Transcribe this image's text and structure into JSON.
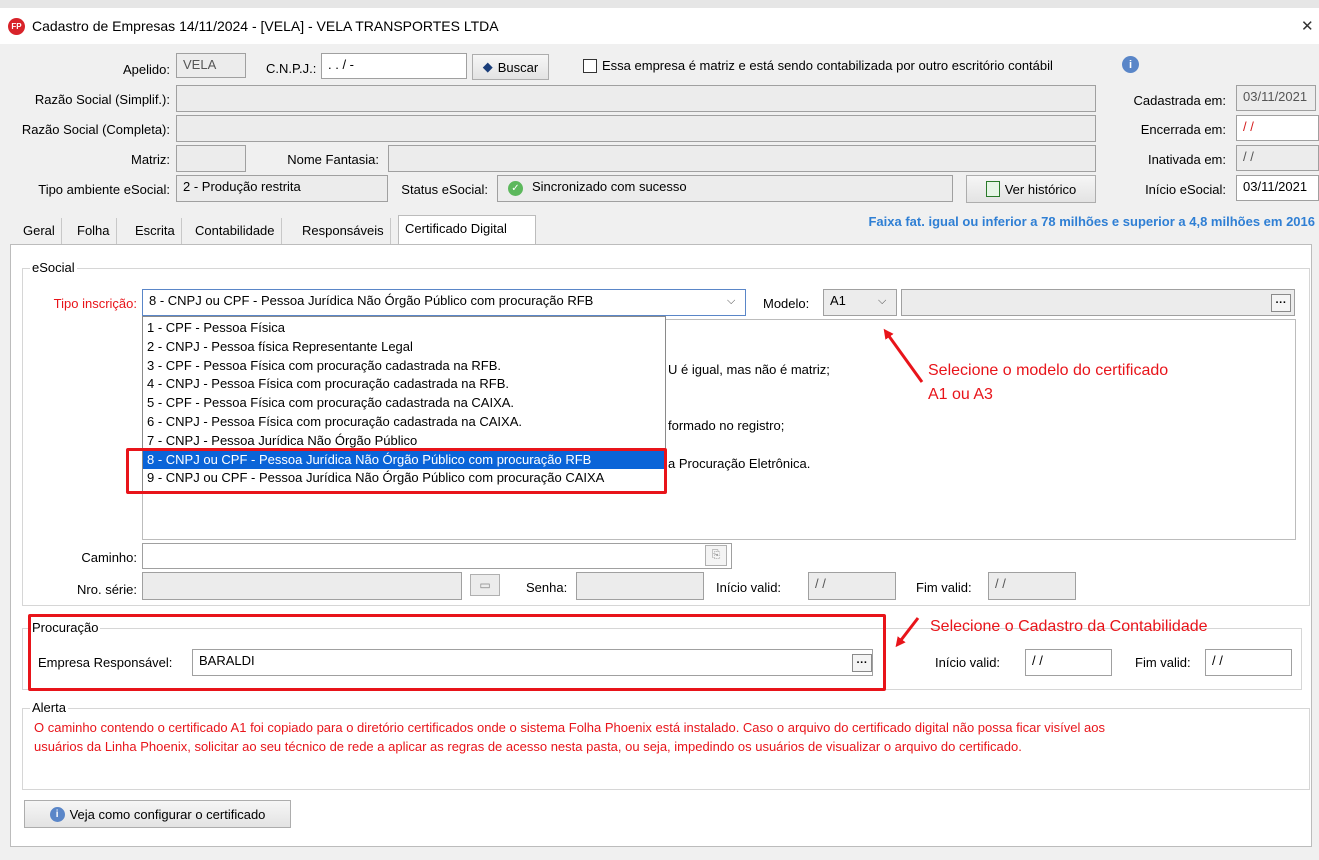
{
  "window": {
    "logo": "FP",
    "title": "Cadastro de Empresas  14/11/2024 - [VELA] - VELA TRANSPORTES LTDA",
    "close_glyph": "✕"
  },
  "header": {
    "apelido_label": "Apelido:",
    "apelido_value": "VELA",
    "cnpj_label": "C.N.P.J.:",
    "cnpj_value": " . . /  -",
    "buscar_label": "Buscar",
    "matriz_checkbox_label": "Essa empresa é matriz e está sendo contabilizada por outro escritório contábil",
    "razao_simpl_label": "Razão Social (Simplif.):",
    "razao_simpl_value": "",
    "razao_compl_label": "Razão Social (Completa):",
    "razao_compl_value": "",
    "matriz_label": "Matriz:",
    "matriz_value": "",
    "nome_fantasia_label": "Nome Fantasia:",
    "nome_fantasia_value": "",
    "tipo_ambiente_label": "Tipo ambiente eSocial:",
    "tipo_ambiente_value": "2 - Produção restrita",
    "status_label": "Status eSocial:",
    "status_value": "Sincronizado com sucesso",
    "ver_historico_label": "Ver histórico",
    "cadastrada_label": "Cadastrada em:",
    "cadastrada_value": "03/11/2021",
    "encerrada_label": "Encerrada em:",
    "encerrada_value": "/ /",
    "inativada_label": "Inativada em:",
    "inativada_value": "/ /",
    "inicio_esocial_label": "Início eSocial:",
    "inicio_esocial_value": "03/11/2021"
  },
  "tabs": [
    {
      "label": "Geral"
    },
    {
      "label": "Folha"
    },
    {
      "label": "Escrita"
    },
    {
      "label": "Contabilidade"
    },
    {
      "label": "Responsáveis"
    },
    {
      "label": "Certificado Digital"
    }
  ],
  "faixa_text": "Faixa fat. igual ou inferior a 78 milhões e superior a 4,8 milhões em 2016",
  "esocial": {
    "group_title": "eSocial",
    "tipo_inscricao_label": "Tipo inscrição:",
    "tipo_inscricao_value": "8 - CNPJ ou CPF - Pessoa Jurídica Não Órgão Público com procuração RFB",
    "modelo_label": "Modelo:",
    "modelo_value": "A1",
    "dropdown_options": [
      "1 - CPF - Pessoa Física",
      "2 - CNPJ - Pessoa física Representante Legal",
      "3 - CPF - Pessoa Física com procuração cadastrada na RFB.",
      "4 - CNPJ - Pessoa Física com procuração cadastrada na RFB.",
      "5 - CPF - Pessoa Física com procuração cadastrada na CAIXA.",
      "6 - CNPJ - Pessoa Física com procuração cadastrada na CAIXA.",
      "7 - CNPJ - Pessoa Jurídica Não Órgão Público",
      "8 - CNPJ ou CPF - Pessoa Jurídica Não Órgão Público com procuração RFB",
      "9 - CNPJ ou CPF - Pessoa Jurídica Não Órgão Público com procuração CAIXA"
    ],
    "selected_option_index": 7,
    "info_line_1": "U é igual, mas não é matriz;",
    "info_line_2": "formado no registro;",
    "info_line_3": "a Procuração Eletrônica.",
    "caminho_label": "Caminho:",
    "caminho_value": "",
    "nro_serie_label": "Nro. série:",
    "nro_serie_value": "",
    "senha_label": "Senha:",
    "senha_value": "",
    "inicio_valid_label": "Início valid:",
    "inicio_valid_value": "/ /",
    "fim_valid_label": "Fim valid:",
    "fim_valid_value": "/ /"
  },
  "procuracao": {
    "group_title": "Procuração",
    "empresa_responsavel_label": "Empresa Responsável:",
    "empresa_responsavel_value": "BARALDI",
    "inicio_valid_label": "Início valid:",
    "inicio_valid_value": "/ /",
    "fim_valid_label": "Fim valid:",
    "fim_valid_value": "/ /"
  },
  "alerta": {
    "group_title": "Alerta",
    "text_line_1": "O caminho contendo o certificado A1 foi copiado para o diretório certificados onde o sistema Folha Phoenix está instalado. Caso o arquivo do certificado digital não possa ficar visível aos",
    "text_line_2": "usuários da Linha Phoenix, solicitar ao seu técnico de rede a aplicar as regras de acesso nesta pasta, ou seja, impedindo os usuários de visualizar o arquivo do certificado."
  },
  "veja_button_label": "Veja como configurar o certificado",
  "annotations": {
    "modelo_line_1": "Selecione o modelo do certificado",
    "modelo_line_2": "A1 ou A3",
    "contabilidade": "Selecione o Cadastro da Contabilidade"
  },
  "colors": {
    "annotation_red": "#e8141a",
    "label_red": "#e8141a",
    "selection_blue": "#0a64d8",
    "faixa_blue": "#2f7fd4"
  }
}
